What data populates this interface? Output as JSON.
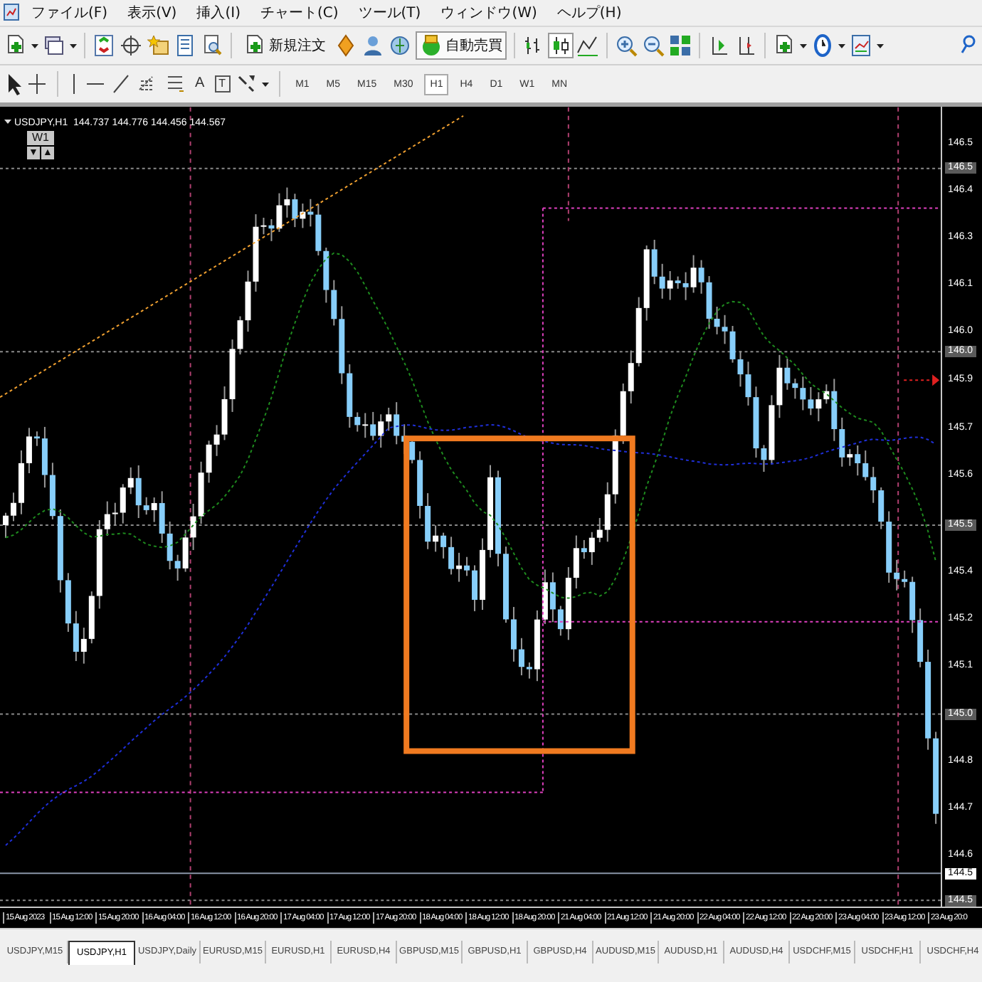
{
  "menu": [
    {
      "label": "ファイル(F)"
    },
    {
      "label": "表示(V)"
    },
    {
      "label": "挿入(I)"
    },
    {
      "label": "チャート(C)"
    },
    {
      "label": "ツール(T)"
    },
    {
      "label": "ウィンドウ(W)"
    },
    {
      "label": "ヘルプ(H)"
    }
  ],
  "toolbar": {
    "new_order": "新規注文",
    "auto_trading": {
      "label": "自動売買",
      "on": true
    },
    "chart_types": [
      {
        "kind": "bar",
        "selected": false
      },
      {
        "kind": "candle",
        "selected": true
      },
      {
        "kind": "line",
        "selected": false
      }
    ]
  },
  "drawing_tools": {
    "text_tool": "A",
    "label_tool": "T"
  },
  "timeframes": [
    {
      "label": "M1",
      "selected": false
    },
    {
      "label": "M5",
      "selected": false
    },
    {
      "label": "M15",
      "selected": false
    },
    {
      "label": "M30",
      "selected": false
    },
    {
      "label": "H1",
      "selected": true
    },
    {
      "label": "H4",
      "selected": false
    },
    {
      "label": "D1",
      "selected": false
    },
    {
      "label": "W1",
      "selected": false
    },
    {
      "label": "MN",
      "selected": false
    }
  ],
  "chart": {
    "title": "USDJPY,H1  144.737 144.776 144.456 144.567",
    "period_button": "W1",
    "scroll_buttons": [
      "▼",
      "▲"
    ]
  },
  "price_axis": [
    {
      "label": "146.5",
      "kind": "tick"
    },
    {
      "label": "146.5",
      "kind": "grid"
    },
    {
      "label": "146.4",
      "kind": "tick"
    },
    {
      "label": "146.3",
      "kind": "tick"
    },
    {
      "label": "146.1",
      "kind": "tick"
    },
    {
      "label": "146.0",
      "kind": "tick"
    },
    {
      "label": "146.0",
      "kind": "grid"
    },
    {
      "label": "145.9",
      "kind": "tick"
    },
    {
      "label": "145.7",
      "kind": "tick"
    },
    {
      "label": "145.6",
      "kind": "tick"
    },
    {
      "label": "145.5",
      "kind": "grid"
    },
    {
      "label": "145.4",
      "kind": "tick"
    },
    {
      "label": "145.2",
      "kind": "tick"
    },
    {
      "label": "145.1",
      "kind": "tick"
    },
    {
      "label": "145.0",
      "kind": "grid"
    },
    {
      "label": "144.8",
      "kind": "tick"
    },
    {
      "label": "144.7",
      "kind": "tick"
    },
    {
      "label": "144.6",
      "kind": "tick"
    },
    {
      "label": "144.5",
      "kind": "bid"
    },
    {
      "label": "144.5",
      "kind": "grid"
    }
  ],
  "time_axis": [
    "15 Aug 2023",
    "15 Aug 12:00",
    "15 Aug 20:00",
    "16 Aug 04:00",
    "16 Aug 12:00",
    "16 Aug 20:00",
    "17 Aug 04:00",
    "17 Aug 12:00",
    "17 Aug 20:00",
    "18 Aug 04:00",
    "18 Aug 12:00",
    "18 Aug 20:00",
    "21 Aug 04:00",
    "21 Aug 12:00",
    "21 Aug 20:00",
    "22 Aug 04:00",
    "22 Aug 12:00",
    "22 Aug 20:00",
    "23 Aug 04:00",
    "23 Aug 12:00",
    "23 Aug 20:0"
  ],
  "tabs": [
    {
      "label": "USDJPY,M15",
      "selected": false
    },
    {
      "label": "USDJPY,H1",
      "selected": true
    },
    {
      "label": "USDJPY,Daily",
      "selected": false
    },
    {
      "label": "EURUSD,M15",
      "selected": false
    },
    {
      "label": "EURUSD,H1",
      "selected": false
    },
    {
      "label": "EURUSD,H4",
      "selected": false
    },
    {
      "label": "GBPUSD,M15",
      "selected": false
    },
    {
      "label": "GBPUSD,H1",
      "selected": false
    },
    {
      "label": "GBPUSD,H4",
      "selected": false
    },
    {
      "label": "AUDUSD,M15",
      "selected": false
    },
    {
      "label": "AUDUSD,H1",
      "selected": false
    },
    {
      "label": "AUDUSD,H4",
      "selected": false
    },
    {
      "label": "USDCHF,M15",
      "selected": false
    },
    {
      "label": "USDCHF,H1",
      "selected": false
    },
    {
      "label": "USDCHF,H4",
      "selected": false
    }
  ]
}
